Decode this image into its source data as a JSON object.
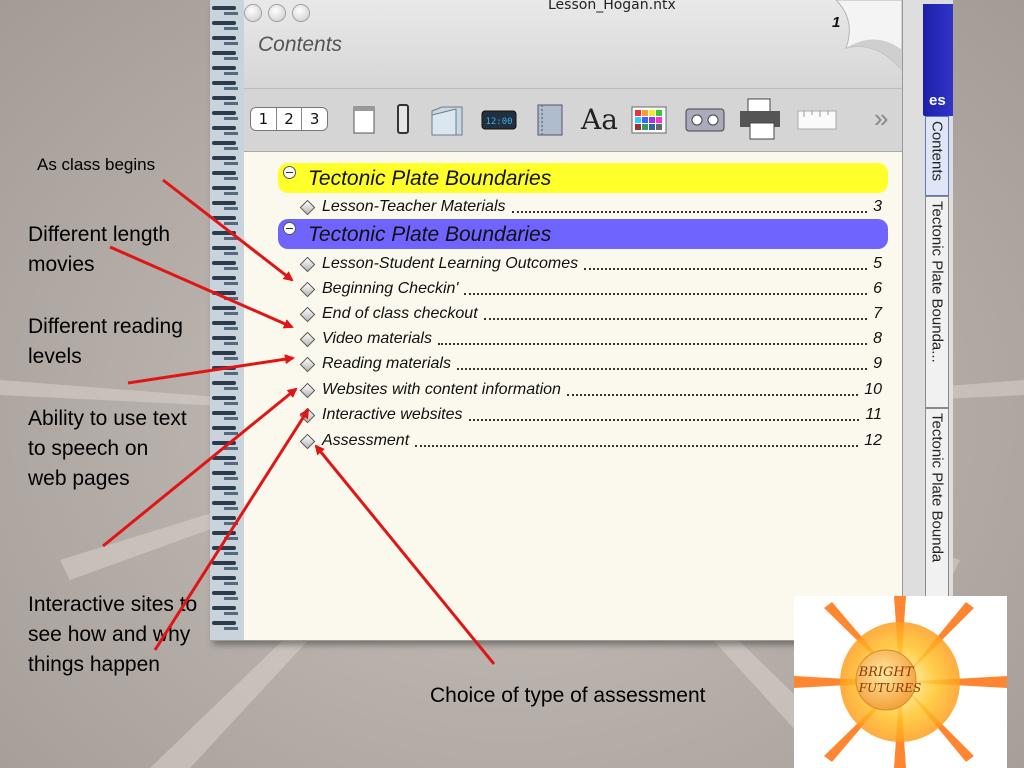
{
  "window": {
    "title": "Lesson_Hogan.ntx",
    "page_number": "1",
    "section_title": "Contents",
    "toolbar": {
      "page_buttons": [
        "1",
        "2",
        "3"
      ],
      "font_button": "Aa",
      "more": "»",
      "icons": [
        "page-icon",
        "device-icon",
        "folder-icon",
        "clock-icon",
        "notebook-icon",
        "font-icon",
        "color-palette-icon",
        "cassette-icon",
        "printer-icon",
        "ruler-icon"
      ]
    },
    "contents": {
      "headings": [
        {
          "label": "Tectonic Plate Boundaries",
          "color": "#ffff2a"
        },
        {
          "label": "Tectonic Plate Boundaries",
          "color": "#7064ff"
        }
      ],
      "entries": [
        {
          "label": "Lesson-Teacher Materials",
          "page": "3"
        },
        {
          "label": "Lesson-Student Learning Outcomes",
          "page": "5"
        },
        {
          "label": "Beginning Checkin'",
          "page": "6"
        },
        {
          "label": "End of class checkout",
          "page": "7"
        },
        {
          "label": "Video materials",
          "page": "8"
        },
        {
          "label": "Reading materials",
          "page": "9"
        },
        {
          "label": "Websites with content information",
          "page": "10"
        },
        {
          "label": "Interactive websites",
          "page": "11"
        },
        {
          "label": "Assessment",
          "page": "12"
        }
      ]
    },
    "side_tabs": {
      "top_label": "es",
      "tabs": [
        "Contents",
        "Tectonic Plate Bounda...",
        "Tectonic Plate Bounda"
      ]
    }
  },
  "annotations": {
    "class_begins": "As class begins",
    "movies": "Different length movies",
    "reading": "Different reading levels",
    "speech": "Ability to use text to speech on web pages",
    "interactive": "Interactive sites to see how and why things happen",
    "assessment": "Choice of type of assessment"
  },
  "logo": {
    "text_line1": "BRIGHT",
    "text_line2": "FUTURES"
  },
  "colors": {
    "arrow": "#e01515",
    "highlight_yellow": "#ffff2a",
    "highlight_purple": "#7064ff"
  }
}
